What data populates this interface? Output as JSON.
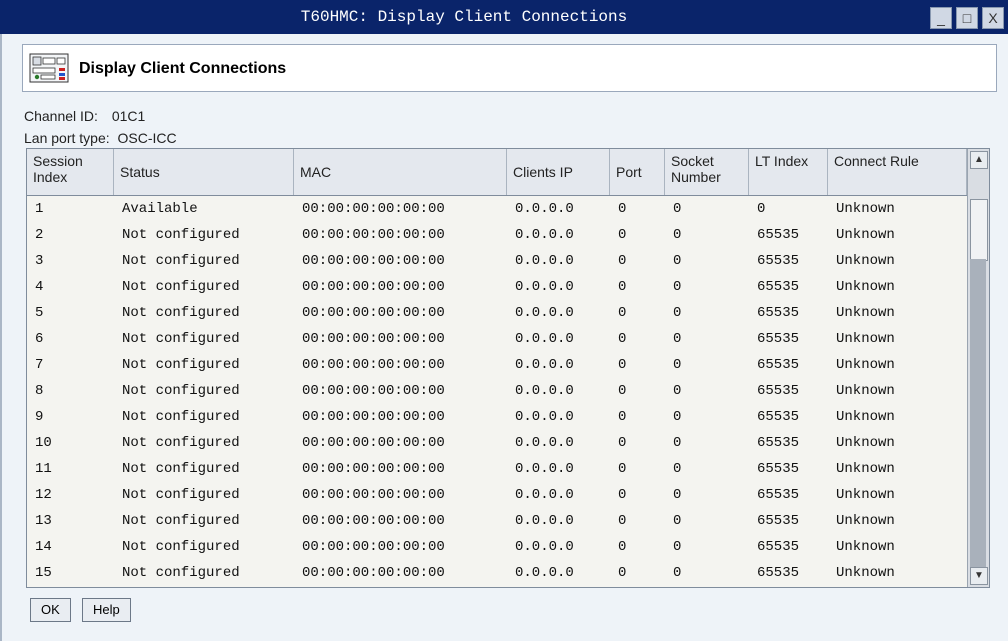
{
  "window": {
    "title": "T60HMC: Display Client Connections",
    "minimize_glyph": "_",
    "maximize_glyph": "□",
    "close_glyph": "X"
  },
  "header": {
    "title": "Display Client Connections",
    "icon": "server-rack-icon"
  },
  "info": {
    "channel_label": "Channel ID:",
    "channel_value": "01C1",
    "lan_label": "Lan port type:",
    "lan_value": "OSC-ICC"
  },
  "table": {
    "columns": [
      "Session Index",
      "Status",
      "MAC",
      "Clients IP",
      "Port",
      "Socket Number",
      "LT Index",
      "Connect Rule"
    ],
    "rows": [
      [
        "1",
        "Available",
        "00:00:00:00:00:00",
        "0.0.0.0",
        "0",
        "0",
        "0",
        "Unknown"
      ],
      [
        "2",
        "Not configured",
        "00:00:00:00:00:00",
        "0.0.0.0",
        "0",
        "0",
        "65535",
        "Unknown"
      ],
      [
        "3",
        "Not configured",
        "00:00:00:00:00:00",
        "0.0.0.0",
        "0",
        "0",
        "65535",
        "Unknown"
      ],
      [
        "4",
        "Not configured",
        "00:00:00:00:00:00",
        "0.0.0.0",
        "0",
        "0",
        "65535",
        "Unknown"
      ],
      [
        "5",
        "Not configured",
        "00:00:00:00:00:00",
        "0.0.0.0",
        "0",
        "0",
        "65535",
        "Unknown"
      ],
      [
        "6",
        "Not configured",
        "00:00:00:00:00:00",
        "0.0.0.0",
        "0",
        "0",
        "65535",
        "Unknown"
      ],
      [
        "7",
        "Not configured",
        "00:00:00:00:00:00",
        "0.0.0.0",
        "0",
        "0",
        "65535",
        "Unknown"
      ],
      [
        "8",
        "Not configured",
        "00:00:00:00:00:00",
        "0.0.0.0",
        "0",
        "0",
        "65535",
        "Unknown"
      ],
      [
        "9",
        "Not configured",
        "00:00:00:00:00:00",
        "0.0.0.0",
        "0",
        "0",
        "65535",
        "Unknown"
      ],
      [
        "10",
        "Not configured",
        "00:00:00:00:00:00",
        "0.0.0.0",
        "0",
        "0",
        "65535",
        "Unknown"
      ],
      [
        "11",
        "Not configured",
        "00:00:00:00:00:00",
        "0.0.0.0",
        "0",
        "0",
        "65535",
        "Unknown"
      ],
      [
        "12",
        "Not configured",
        "00:00:00:00:00:00",
        "0.0.0.0",
        "0",
        "0",
        "65535",
        "Unknown"
      ],
      [
        "13",
        "Not configured",
        "00:00:00:00:00:00",
        "0.0.0.0",
        "0",
        "0",
        "65535",
        "Unknown"
      ],
      [
        "14",
        "Not configured",
        "00:00:00:00:00:00",
        "0.0.0.0",
        "0",
        "0",
        "65535",
        "Unknown"
      ],
      [
        "15",
        "Not configured",
        "00:00:00:00:00:00",
        "0.0.0.0",
        "0",
        "0",
        "65535",
        "Unknown"
      ]
    ]
  },
  "buttons": {
    "ok": "OK",
    "help": "Help"
  },
  "scrollbar": {
    "up_glyph": "▲",
    "down_glyph": "▼"
  },
  "colors": {
    "titlebar": "#0a246a",
    "background": "#eef3f8"
  }
}
